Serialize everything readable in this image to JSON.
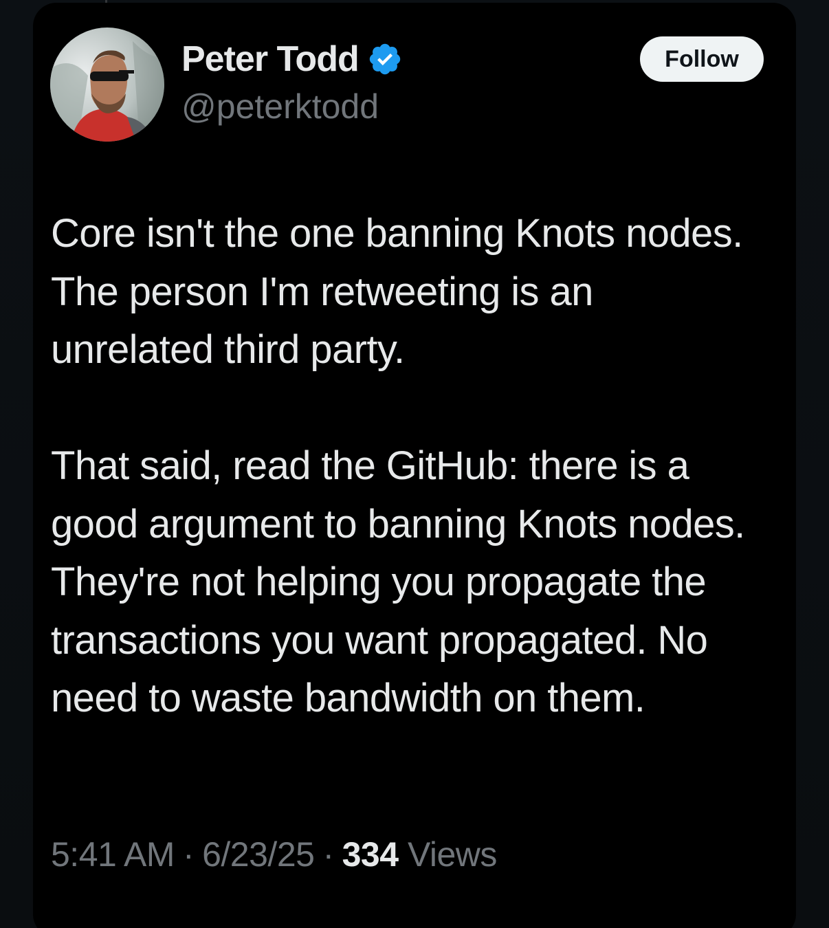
{
  "tweet": {
    "author": {
      "display_name": "Peter Todd",
      "handle": "@peterktodd",
      "verified": true
    },
    "follow_label": "Follow",
    "paragraphs": [
      "Core isn't the one banning Knots nodes. The person I'm retweeting is an unrelated third party.",
      "That said, read the GitHub: there is a good argument to banning Knots nodes. They're not helping you propagate the transactions you want propagated. No need to waste bandwidth on them."
    ],
    "time": "5:41 AM",
    "date": "6/23/25",
    "separator": "·",
    "views_count": "334",
    "views_label": "Views"
  },
  "colors": {
    "background": "#000000",
    "text_primary": "#e7e9ea",
    "text_secondary": "#71767b",
    "verified_badge": "#1d9bf0",
    "follow_button_bg": "#eff3f4"
  },
  "icons": {
    "verified": "verified-badge-icon"
  }
}
